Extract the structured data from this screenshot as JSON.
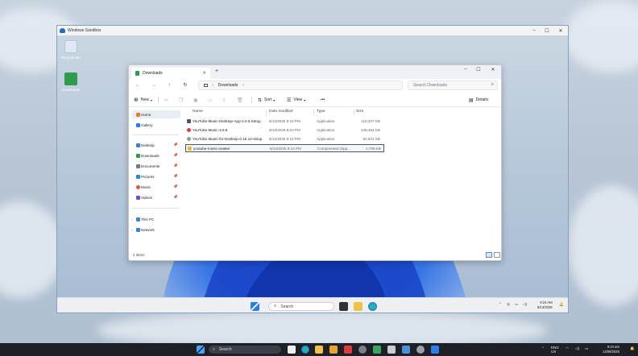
{
  "sandbox": {
    "title": "Windows Sandbox",
    "controls": [
      "–",
      "☐",
      "✕"
    ]
  },
  "desktop_icons": [
    {
      "label": "Recycle Bin",
      "icon": "recycle-bin-icon"
    },
    {
      "label": "Downloads",
      "icon": "downloads-folder-icon"
    }
  ],
  "explorer": {
    "tab_title": "Downloads",
    "tab_close": "✕",
    "new_tab": "+",
    "window_controls": [
      "–",
      "☐",
      "✕"
    ],
    "nav": {
      "back": "←",
      "forward": "→",
      "up": "↑",
      "refresh": "↻"
    },
    "breadcrumb": [
      "Downloads"
    ],
    "search_placeholder": "Search Downloads",
    "toolbar": {
      "new_label": "New",
      "sort_label": "Sort",
      "view_label": "View",
      "more": "•••",
      "details_label": "Details"
    },
    "sidebar": {
      "top": [
        {
          "label": "Home",
          "icon": "home-icon",
          "color": "#e87a2d",
          "selected": true
        },
        {
          "label": "Gallery",
          "icon": "gallery-icon",
          "color": "#2d7de8",
          "selected": false
        }
      ],
      "quick": [
        {
          "label": "Desktop",
          "icon": "desktop-folder-icon",
          "color": "#3b82d6"
        },
        {
          "label": "Downloads",
          "icon": "downloads-folder-icon",
          "color": "#2e9b4f"
        },
        {
          "label": "Documents",
          "icon": "documents-folder-icon",
          "color": "#6b7a8c"
        },
        {
          "label": "Pictures",
          "icon": "pictures-folder-icon",
          "color": "#2a8ad4"
        },
        {
          "label": "Music",
          "icon": "music-folder-icon",
          "color": "#e0563a"
        },
        {
          "label": "Videos",
          "icon": "videos-folder-icon",
          "color": "#7b4ad1"
        }
      ],
      "bottom": [
        {
          "label": "This PC",
          "icon": "this-pc-icon",
          "color": "#3b82d6"
        },
        {
          "label": "Network",
          "icon": "network-icon",
          "color": "#3b82d6"
        }
      ]
    },
    "columns": [
      "Name",
      "Date modified",
      "Type",
      "Size"
    ],
    "files": [
      {
        "name": "YouTube-Music-Desktop-App-2.0.5.Setup",
        "date": "8/13/2025 8:15 PM",
        "type": "Application",
        "size": "118,327 KB",
        "icon_color": "#555555",
        "selected": false
      },
      {
        "name": "YouTube-Music-3.8.6",
        "date": "8/13/2025 8:03 PM",
        "type": "Application",
        "size": "248,464 KB",
        "icon_color": "#e23b3b",
        "selected": false
      },
      {
        "name": "YouTube-Music-for-Desktop-0.18.14-setup",
        "date": "8/13/2025 8:15 PM",
        "type": "Application",
        "size": "84,921 KB",
        "icon_color": "#9a9a9a",
        "selected": false
      },
      {
        "name": "youtube-music-master",
        "date": "8/13/2025 8:16 PM",
        "type": "Compressed (zipp...",
        "size": "2,759 KB",
        "icon_color": "#e7b84a",
        "selected": true
      }
    ],
    "status": "4 items"
  },
  "sandbox_taskbar": {
    "search_label": "Search",
    "time": "9:24 AM",
    "date": "8/14/2025"
  },
  "host_taskbar": {
    "search_label": "Search",
    "lang": "ENG",
    "lang2": "US",
    "time": "9:24 am",
    "date": "14/08/2025"
  }
}
